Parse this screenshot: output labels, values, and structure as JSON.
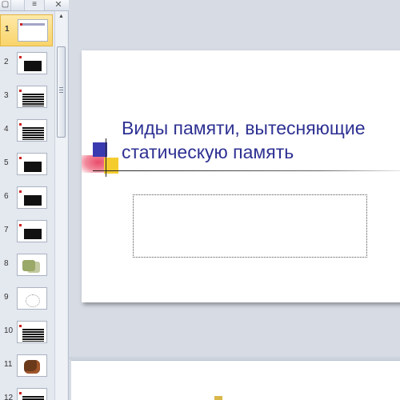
{
  "left_pane": {
    "tabs": {
      "slides_icon": "slides-tab-icon",
      "outline_icon": "outline-tab-icon",
      "close_glyph": "✕"
    },
    "selected_slide": 1,
    "slides": [
      {
        "number": "1",
        "thumb": "title"
      },
      {
        "number": "2",
        "thumb": "block"
      },
      {
        "number": "3",
        "thumb": "text"
      },
      {
        "number": "4",
        "thumb": "text"
      },
      {
        "number": "5",
        "thumb": "block"
      },
      {
        "number": "6",
        "thumb": "block"
      },
      {
        "number": "7",
        "thumb": "block"
      },
      {
        "number": "8",
        "thumb": "image"
      },
      {
        "number": "9",
        "thumb": "sketch"
      },
      {
        "number": "10",
        "thumb": "text"
      },
      {
        "number": "11",
        "thumb": "photo"
      },
      {
        "number": "12",
        "thumb": "text"
      }
    ]
  },
  "slide": {
    "title": "Виды памяти, вытесняющие статическую память",
    "subtitle": ""
  },
  "notes": {
    "text": ""
  },
  "colors": {
    "title": "#2e3192",
    "selection": "#f9d46b",
    "deco_blue": "#3a3ab0",
    "deco_yellow": "#f5cc2e",
    "deco_red": "#e94b6a"
  }
}
